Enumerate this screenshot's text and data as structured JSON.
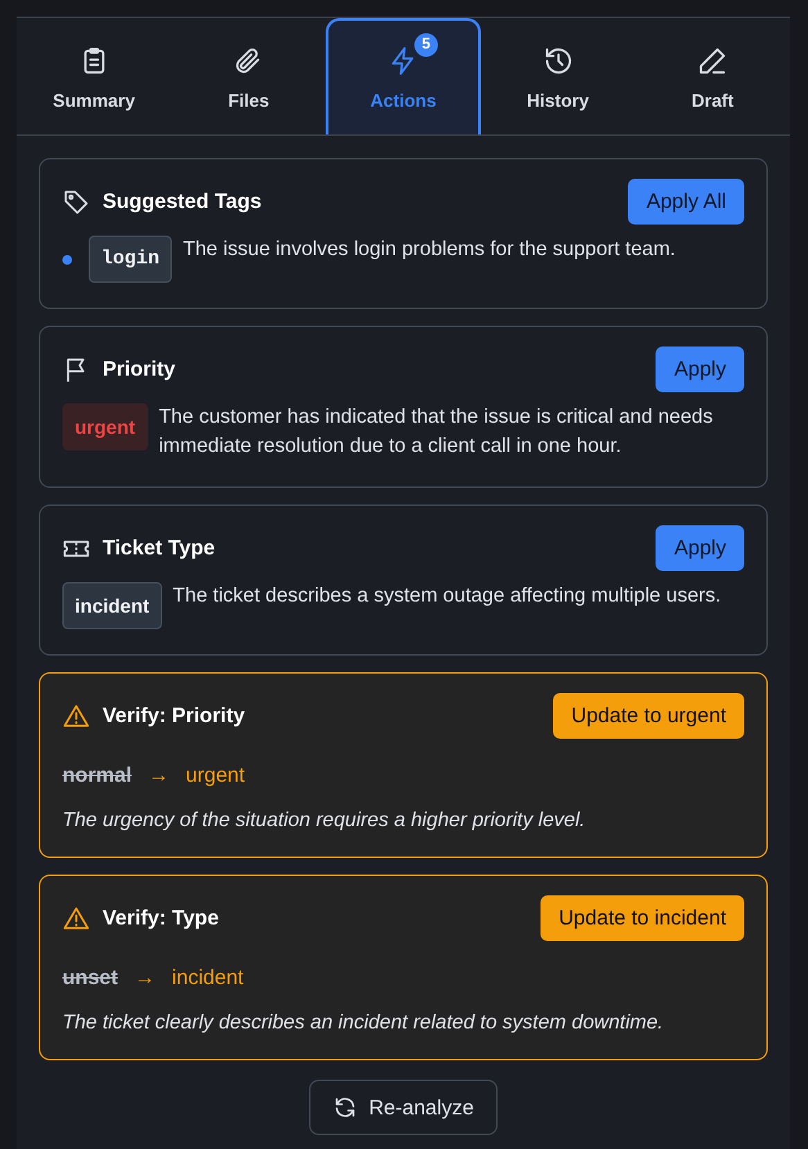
{
  "tabs": [
    {
      "label": "Summary",
      "kind": "clipboard",
      "selected": false
    },
    {
      "label": "Files",
      "kind": "paperclip",
      "selected": false
    },
    {
      "label": "Actions",
      "kind": "bolt",
      "selected": true,
      "badge": "5"
    },
    {
      "label": "History",
      "kind": "history",
      "selected": false
    },
    {
      "label": "Draft",
      "kind": "pencil",
      "selected": false
    }
  ],
  "cards": [
    {
      "kind": "tags",
      "title": "Suggested Tags",
      "button": "Apply All",
      "tags": [
        {
          "label": "login",
          "color": "#3b82f6",
          "reason": "The issue involves login problems for the support team."
        }
      ]
    },
    {
      "kind": "priority",
      "title": "Priority",
      "button": "Apply",
      "value": "urgent",
      "reason": "The customer has indicated that the issue is critical and needs immediate resolution due to a client call in one hour."
    },
    {
      "kind": "type",
      "title": "Ticket Type",
      "button": "Apply",
      "value": "incident",
      "reason": "The ticket describes a system outage affecting multiple users."
    },
    {
      "kind": "verify",
      "title": "Verify: Priority",
      "button": "Update to urgent",
      "from": "normal",
      "arrow": "→",
      "to": "urgent",
      "reason": "The urgency of the situation requires a higher priority level."
    },
    {
      "kind": "verify",
      "title": "Verify: Type",
      "button": "Update to incident",
      "from": "unset",
      "arrow": "→",
      "to": "incident",
      "reason": "The ticket clearly describes an incident related to system downtime."
    }
  ],
  "reanalyze": "Re-analyze"
}
